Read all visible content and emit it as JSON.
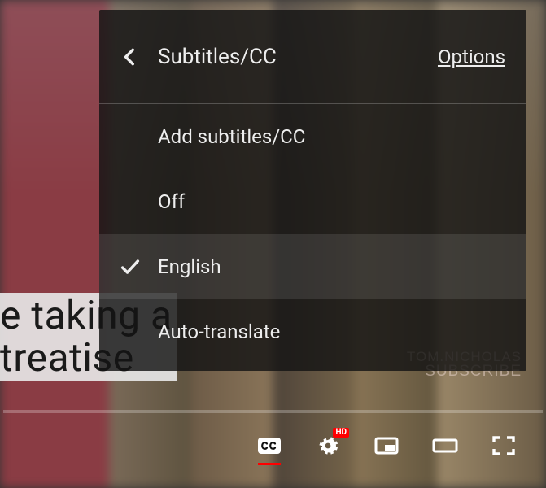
{
  "menu": {
    "title": "Subtitles/CC",
    "options_label": "Options",
    "items": [
      {
        "label": "Add subtitles/CC",
        "selected": false
      },
      {
        "label": "Off",
        "selected": false
      },
      {
        "label": "English",
        "selected": true
      },
      {
        "label": "Auto-translate",
        "selected": false
      }
    ]
  },
  "caption": {
    "line1": "e taking a",
    "line2": "treatise"
  },
  "watermark": {
    "name": "TOM.NICHOLAS",
    "subscribe": "SUBSCRIBE"
  },
  "controls": {
    "cc_active": true,
    "hd_badge": "HD"
  },
  "progress": {
    "played_percent": 0
  }
}
